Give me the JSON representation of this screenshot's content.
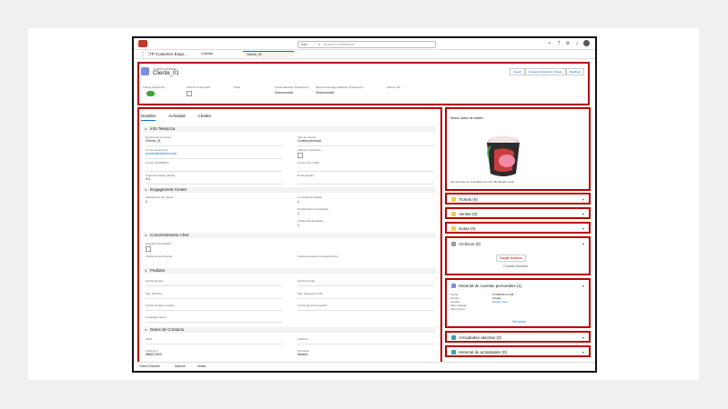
{
  "colors": {
    "brand": "#c0392b",
    "accent": "#0070d2",
    "highlight": "#b00000"
  },
  "topbar": {
    "search_scope": "Todo",
    "search_placeholder": "Buscar en Salesforce"
  },
  "nav": {
    "app_name": "TP Customer Engo...",
    "object_select": "Cuentas",
    "tab_label": "Cliente_01"
  },
  "record": {
    "type": "Cuenta personal",
    "name": "Cliente_01",
    "actions": [
      "Seguir",
      "Creación Rápida de Tickets",
      "Modificar"
    ],
    "fields": [
      {
        "label": "Cliente Satisfecho",
        "value": ""
      },
      {
        "label": "Cliente Consumidor",
        "value": ""
      },
      {
        "label": "Telép",
        "value": ""
      },
      {
        "label": "Canal Habitual (Traducción)",
        "value": "Desconocido"
      },
      {
        "label": "Modo de Entrega Habitual (Traducción)",
        "value": "Desconocido"
      },
      {
        "label": "Cliente VIP",
        "value": "-"
      }
    ]
  },
  "tabs": [
    "Detalles",
    "Actividad",
    "Chatter"
  ],
  "sections": {
    "info": "Info Telepizza",
    "engagement": "Engagement Center",
    "consent": "Consentimiento Chat",
    "orders": "Pedidos",
    "contact": "Datos de Contacto"
  },
  "info_fields": [
    {
      "label": "Nombre de la cuenta",
      "value": "Cliente_01"
    },
    {
      "label": "Tipo de cuenta",
      "value": "Cuenta personal"
    },
    {
      "label": "Correo electrónico",
      "value": "prueba@dominio.com"
    },
    {
      "label": "Cliente Corporativo",
      "value": ""
    },
    {
      "label": "Correo NAOSMON",
      "value": ""
    },
    {
      "label": "Correo Pre-FTRE",
      "value": ""
    },
    {
      "label": "CustomerInsight_Rating",
      "value": "N-1"
    },
    {
      "label": "Es Empleado",
      "value": ""
    }
  ],
  "engagement_fields": [
    {
      "label": "Satisfacción del cliente",
      "value": "0"
    },
    {
      "label": "Consultas Enviadas",
      "value": "1"
    },
    {
      "label": "Reclamaciones Enviadas",
      "value": "1"
    },
    {
      "label": "Incidencias Enviadas",
      "value": "1"
    }
  ],
  "consent_fields": [
    {
      "label": "Acepta IF Privacidad",
      "value": ""
    },
    {
      "label": "Fecha consentimiento",
      "value": ""
    },
    {
      "label": "Fecha revocación consentimiento",
      "value": ""
    }
  ],
  "order_fields": [
    {
      "label": "Fecha del Hito",
      "value": ""
    },
    {
      "label": "Fecha de bajo",
      "value": ""
    },
    {
      "label": "Seg. Modelos",
      "value": ""
    },
    {
      "label": "Seg. Segmento (OP)",
      "value": ""
    },
    {
      "label": "Fecha de último pedido",
      "value": ""
    },
    {
      "label": "Fecha del primer pedido",
      "value": ""
    },
    {
      "label": "Campaign Name",
      "value": ""
    }
  ],
  "contact_fields": [
    {
      "label": "Móvil",
      "value": ""
    },
    {
      "label": "Teléfono",
      "value": ""
    },
    {
      "label": "Teléfono 2",
      "value": "888213399"
    },
    {
      "label": "Provincia",
      "value": "Madrid"
    }
  ],
  "sidebar": {
    "image_title": "Nuevo sabor de helado",
    "image_credit": "Uso de fotos en Unsplash.com Por ella Marida Louis",
    "cards": [
      {
        "title": "Tickets (0)",
        "color": "#f7c94a"
      },
      {
        "title": "Ventas (0)",
        "color": "#f7c94a"
      },
      {
        "title": "Notas (0)",
        "color": "#f7c94a"
      },
      {
        "title": "Archivos (0)",
        "color": "#999999",
        "upload": "Cargar archivos",
        "drop": "O suelte archivos"
      },
      {
        "title": "Historial de cuentas personales (1)",
        "color": "#7f8de1",
        "rows": [
          [
            "Fecha",
            "17/08/2023 11:08"
          ],
          [
            "Campo",
            "Creado."
          ],
          [
            "Usuario",
            "System User"
          ],
          [
            "Valor original",
            ""
          ],
          [
            "Valor nuevo",
            ""
          ]
        ],
        "view_all": "Ver todos"
      },
      {
        "title": "Actividades abiertas (0)",
        "color": "#3ba0a8"
      },
      {
        "title": "Historial de actividades (0)",
        "color": "#3ba0a8"
      }
    ]
  },
  "footer": {
    "items": [
      "Omni-Channel",
      "Macros",
      "Notes"
    ]
  }
}
